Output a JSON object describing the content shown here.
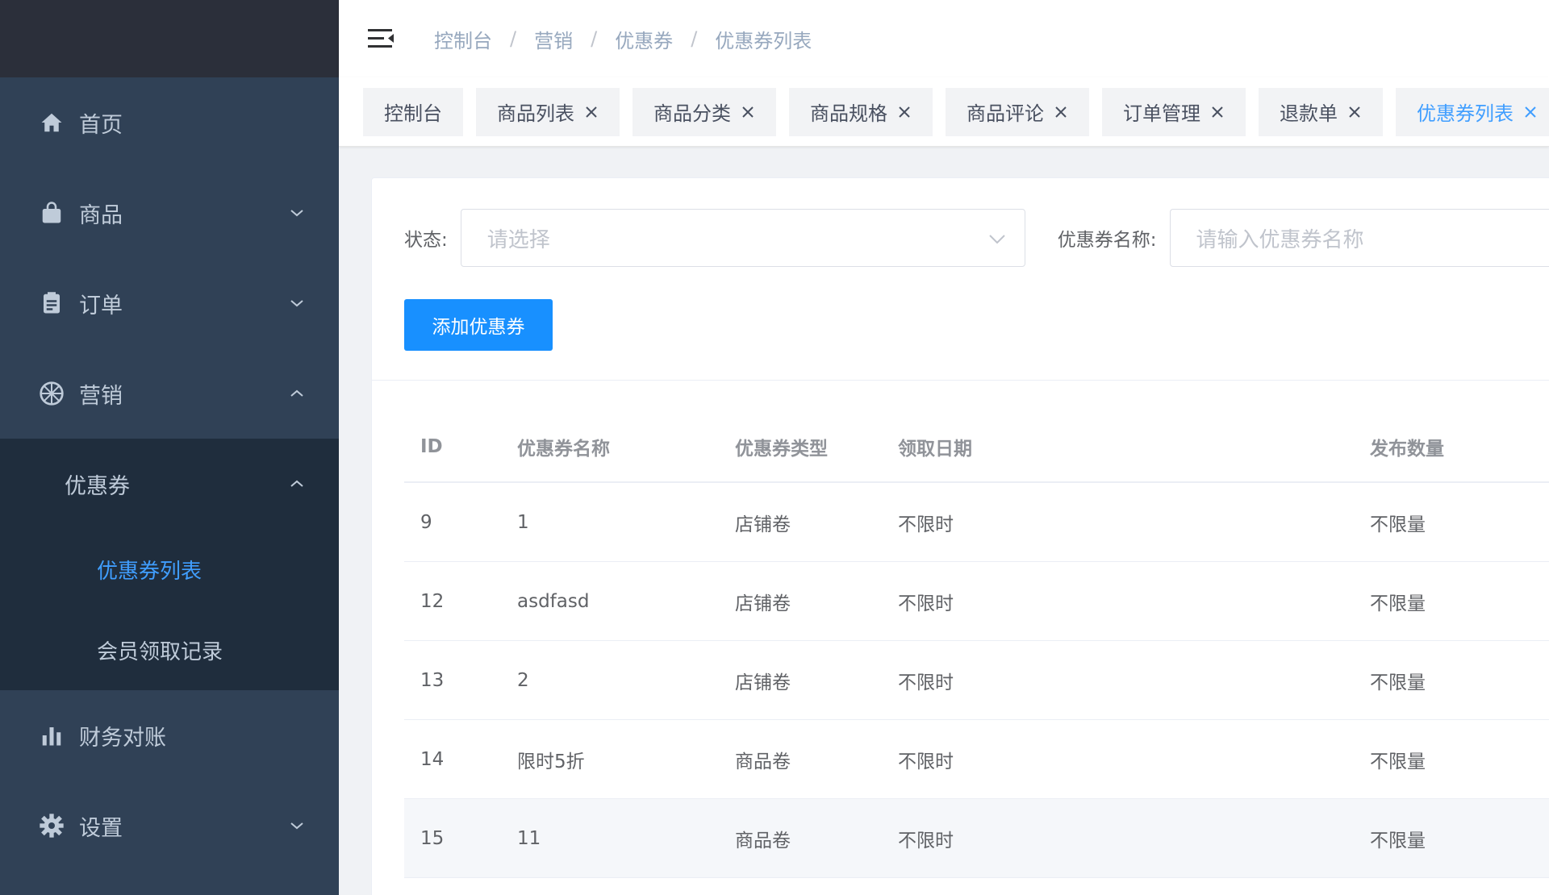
{
  "sidebar": {
    "items": [
      {
        "label": "首页",
        "icon": "home-icon"
      },
      {
        "label": "商品",
        "icon": "bag-icon"
      },
      {
        "label": "订单",
        "icon": "clipboard-icon"
      },
      {
        "label": "营销",
        "icon": "aperture-icon"
      },
      {
        "label": "财务对账",
        "icon": "bar-chart-icon"
      },
      {
        "label": "设置",
        "icon": "gear-icon"
      }
    ],
    "submenu": {
      "label": "优惠券",
      "children": [
        {
          "label": "优惠券列表"
        },
        {
          "label": "会员领取记录"
        }
      ]
    }
  },
  "breadcrumb": [
    "控制台",
    "营销",
    "优惠券",
    "优惠券列表"
  ],
  "tags": [
    "控制台",
    "商品列表",
    "商品分类",
    "商品规格",
    "商品评论",
    "订单管理",
    "退款单",
    "优惠券列表"
  ],
  "filter": {
    "status_label": "状态:",
    "status_placeholder": "请选择",
    "name_label": "优惠券名称:",
    "name_placeholder": "请输入优惠券名称"
  },
  "actions": {
    "add_label": "添加优惠券"
  },
  "table": {
    "headers": [
      "ID",
      "优惠券名称",
      "优惠券类型",
      "领取日期",
      "发布数量"
    ],
    "rows": [
      [
        "9",
        "1",
        "店铺卷",
        "不限时",
        "不限量"
      ],
      [
        "12",
        "asdfasd",
        "店铺卷",
        "不限时",
        "不限量"
      ],
      [
        "13",
        "2",
        "店铺卷",
        "不限时",
        "不限量"
      ],
      [
        "14",
        "限时5折",
        "商品卷",
        "不限时",
        "不限量"
      ],
      [
        "15",
        "11",
        "商品卷",
        "不限时",
        "不限量"
      ]
    ]
  },
  "colors": {
    "sidebar_bg": "#304156",
    "submenu_bg": "#1f2d3d",
    "accent": "#409eff",
    "button": "#1890ff"
  }
}
